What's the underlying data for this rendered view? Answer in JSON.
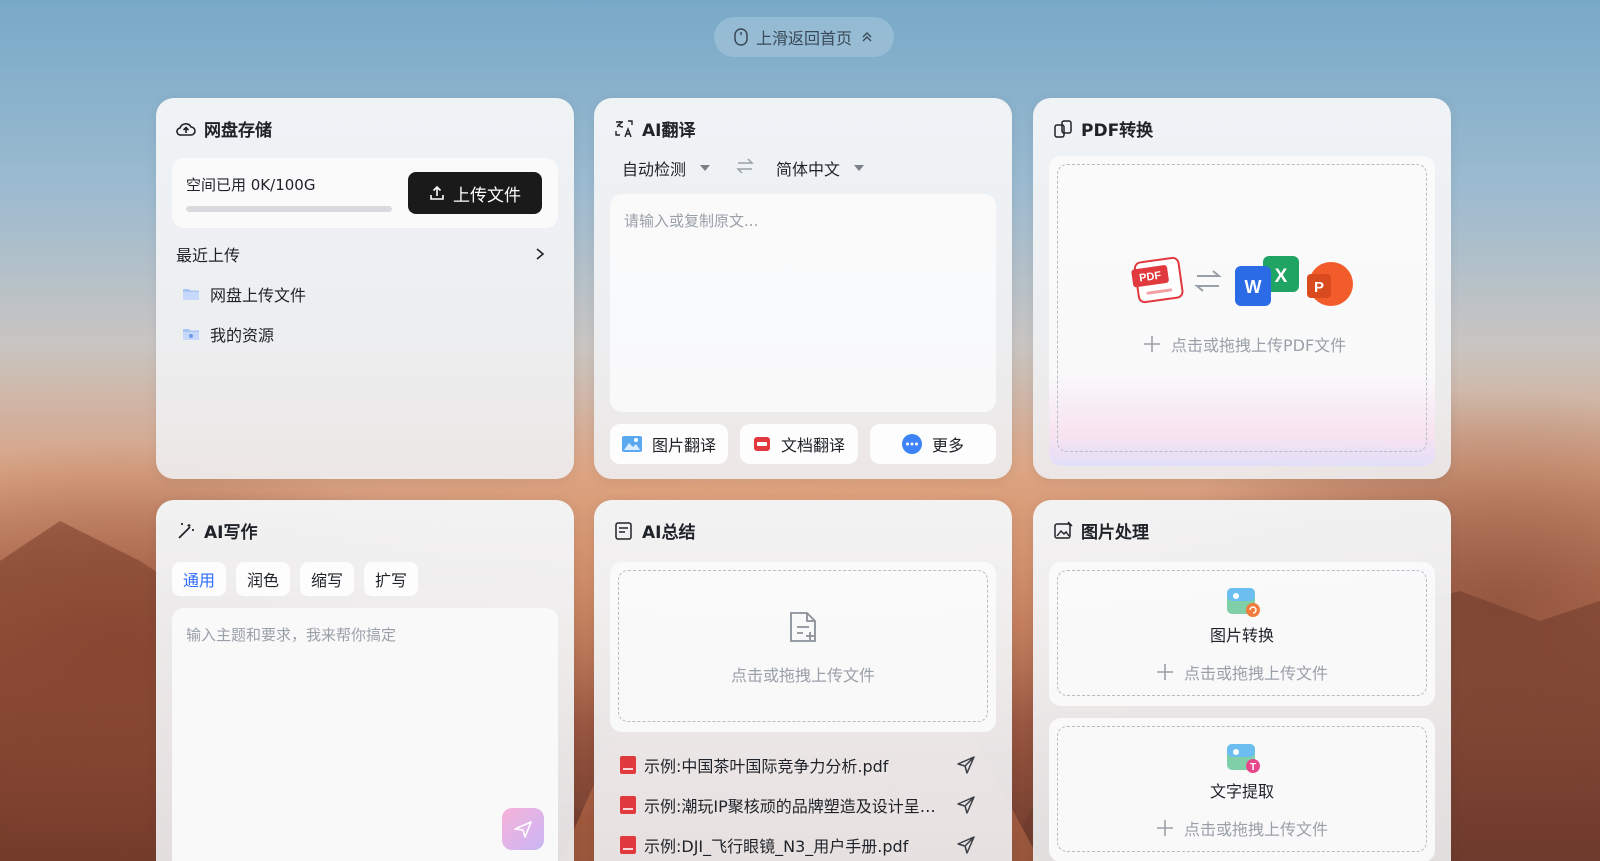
{
  "nav": {
    "scroll_home_label": "上滑返回首页"
  },
  "cloud": {
    "title": "网盘存储",
    "usage_text": "空间已用 0K/100G",
    "usage_fraction": 0,
    "upload_button": "上传文件",
    "recent_label": "最近上传",
    "folders": [
      {
        "label": "网盘上传文件",
        "icon": "folder-icon"
      },
      {
        "label": "我的资源",
        "icon": "folder-icon"
      }
    ]
  },
  "translate": {
    "title": "AI翻译",
    "source_lang": "自动检测",
    "target_lang": "简体中文",
    "placeholder": "请输入或复制原文...",
    "tools": [
      {
        "label": "图片翻译",
        "icon": "image-icon"
      },
      {
        "label": "文档翻译",
        "icon": "pdf-doc-icon"
      },
      {
        "label": "更多",
        "icon": "more-icon"
      }
    ]
  },
  "pdf": {
    "title": "PDF转换",
    "upload_hint": "点击或拖拽上传PDF文件"
  },
  "writing": {
    "title": "AI写作",
    "tabs": [
      "通用",
      "润色",
      "缩写",
      "扩写"
    ],
    "active_tab": 0,
    "placeholder": "输入主题和要求，我来帮你搞定"
  },
  "summary": {
    "title": "AI总结",
    "upload_hint": "点击或拖拽上传文件",
    "examples": [
      "示例:中国茶叶国际竞争力分析.pdf",
      "示例:潮玩IP聚核顽的品牌塑造及设计呈现.pdf",
      "示例:DJI_飞行眼镜_N3_用户手册.pdf"
    ]
  },
  "image": {
    "title": "图片处理",
    "panels": [
      {
        "label": "图片转换",
        "hint": "点击或拖拽上传文件"
      },
      {
        "label": "文字提取",
        "hint": "点击或拖拽上传文件"
      }
    ]
  },
  "colors": {
    "accent": "#2f6bff",
    "dark_button": "#1a1a1a",
    "pdf_red": "#e0393e",
    "word_blue": "#2b6be6",
    "excel_green": "#1fa463",
    "ppt_orange": "#f25c2a"
  }
}
